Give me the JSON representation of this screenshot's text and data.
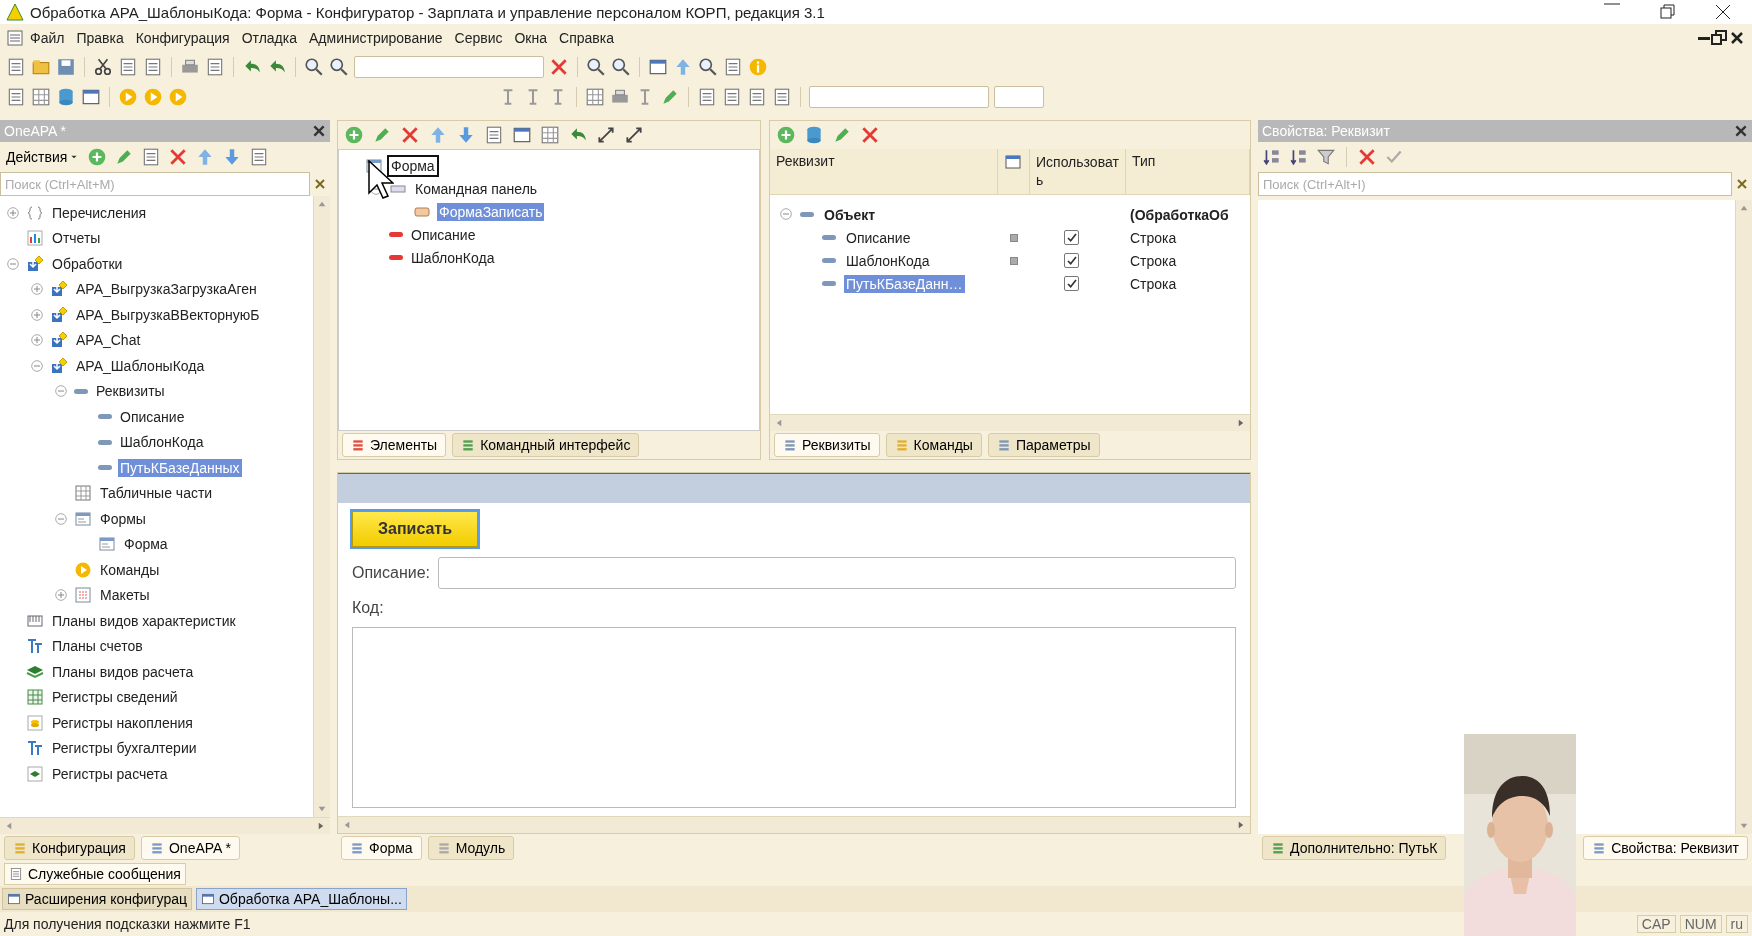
{
  "window": {
    "title": "Обработка APA_ШаблоныКода: Форма - Конфигуратор - Зарплата и управление персоналом КОРП, редакция 3.1"
  },
  "menu": [
    "Файл",
    "Правка",
    "Конфигурация",
    "Отладка",
    "Администрирование",
    "Сервис",
    "Окна",
    "Справка"
  ],
  "config_panel": {
    "title": "OneAPA *",
    "actions_label": "Действия",
    "search": {
      "placeholder": "Поиск (Ctrl+Alt+M)"
    },
    "tree": [
      {
        "label": "Перечисления",
        "kind": "enum",
        "expanded": false,
        "selected": false
      },
      {
        "label": "Отчеты",
        "kind": "report",
        "selected": false
      },
      {
        "label": "Обработки",
        "kind": "processing",
        "expanded": true,
        "selected": false,
        "children": [
          {
            "label": "APA_ВыгрузкаЗагрузкаАген",
            "kind": "processing",
            "expanded": false,
            "selected": false
          },
          {
            "label": "APA_ВыгрузкаВВекторнуюБ",
            "kind": "processing",
            "expanded": false,
            "selected": false
          },
          {
            "label": "APA_Chat",
            "kind": "processing",
            "expanded": false,
            "selected": false
          },
          {
            "label": "APA_ШаблоныКода",
            "kind": "processing",
            "expanded": true,
            "selected": false,
            "children": [
              {
                "label": "Реквизиты",
                "kind": "attribute",
                "expanded": true,
                "selected": false,
                "children": [
                  {
                    "label": "Описание",
                    "kind": "attribute",
                    "selected": false
                  },
                  {
                    "label": "ШаблонКода",
                    "kind": "attribute",
                    "selected": false
                  },
                  {
                    "label": "ПутьКБазеДанных",
                    "kind": "attribute",
                    "selected": true
                  }
                ]
              },
              {
                "label": "Табличные части",
                "kind": "tabular",
                "selected": false
              },
              {
                "label": "Формы",
                "kind": "form",
                "expanded": true,
                "selected": false,
                "children": [
                  {
                    "label": "Форма",
                    "kind": "form",
                    "selected": false
                  }
                ]
              },
              {
                "label": "Команды",
                "kind": "commands",
                "selected": false
              },
              {
                "label": "Макеты",
                "kind": "templates",
                "expanded": false,
                "selected": false
              }
            ]
          }
        ]
      },
      {
        "label": "Планы видов характеристик",
        "kind": "chart-types",
        "selected": false
      },
      {
        "label": "Планы счетов",
        "kind": "accounts",
        "selected": false
      },
      {
        "label": "Планы видов расчета",
        "kind": "calc-types",
        "selected": false
      },
      {
        "label": "Регистры сведений",
        "kind": "info-reg",
        "selected": false
      },
      {
        "label": "Регистры накопления",
        "kind": "accum-reg",
        "selected": false
      },
      {
        "label": "Регистры бухгалтерии",
        "kind": "accounts",
        "selected": false
      },
      {
        "label": "Регистры расчета",
        "kind": "calc-reg",
        "selected": false
      }
    ],
    "tabs": [
      {
        "label": "Конфигурация",
        "selected": false
      },
      {
        "label": "OneAPA *",
        "selected": true
      }
    ]
  },
  "elements_panel": {
    "tree": [
      {
        "label": "Форма",
        "kind": "form",
        "focused": true,
        "selected": false,
        "children": [
          {
            "label": "Командная панель",
            "kind": "command-bar",
            "expanded": true,
            "selected": false,
            "children": [
              {
                "label": "ФормаЗаписать",
                "kind": "button",
                "selected": true
              }
            ]
          },
          {
            "label": "Описание",
            "kind": "field",
            "selected": false
          },
          {
            "label": "ШаблонКода",
            "kind": "field",
            "selected": false
          }
        ]
      }
    ],
    "tabs": [
      {
        "label": "Элементы",
        "selected": true
      },
      {
        "label": "Командный интерфейс",
        "selected": false
      }
    ]
  },
  "attributes_panel": {
    "columns": [
      "Реквизит",
      "Использовать",
      "Тип"
    ],
    "rows": [
      {
        "name": "Объект",
        "kind": "object",
        "expanded": true,
        "type": "(ОбработкаОб",
        "selected": false
      },
      {
        "name": "Описание",
        "kind": "attribute",
        "marked": true,
        "used": true,
        "type": "Строка",
        "selected": false
      },
      {
        "name": "ШаблонКода",
        "kind": "attribute",
        "marked": true,
        "used": true,
        "type": "Строка",
        "selected": false
      },
      {
        "name": "ПутьКБазеДанн…",
        "kind": "attribute",
        "marked": false,
        "used": true,
        "type": "Строка",
        "selected": true
      }
    ],
    "tabs": [
      {
        "label": "Реквизиты",
        "selected": true
      },
      {
        "label": "Команды",
        "selected": false
      },
      {
        "label": "Параметры",
        "selected": false
      }
    ]
  },
  "form_preview": {
    "button": "Записать",
    "fields": [
      {
        "label": "Описание:",
        "kind": "line"
      },
      {
        "label": "Код:",
        "kind": "text"
      }
    ],
    "tabs": [
      {
        "label": "Форма",
        "selected": true
      },
      {
        "label": "Модуль",
        "selected": false
      }
    ]
  },
  "properties_panel": {
    "title": "Свойства: Реквизит",
    "search": {
      "placeholder": "Поиск (Ctrl+Alt+I)"
    },
    "tabs": [
      {
        "label": "Дополнительно: ПутьК",
        "selected": false
      },
      {
        "label": "Свойства: Реквизит",
        "selected": true
      }
    ]
  },
  "messages_tab": "Служебные сообщения",
  "taskbar": [
    {
      "label": "Расширения конфигурац",
      "selected": false
    },
    {
      "label": "Обработка APA_Шаблоны...",
      "selected": true
    }
  ],
  "status_bar": {
    "hint": "Для получения подсказки нажмите F1",
    "indicators": [
      "CAP",
      "NUM",
      "ru"
    ]
  }
}
